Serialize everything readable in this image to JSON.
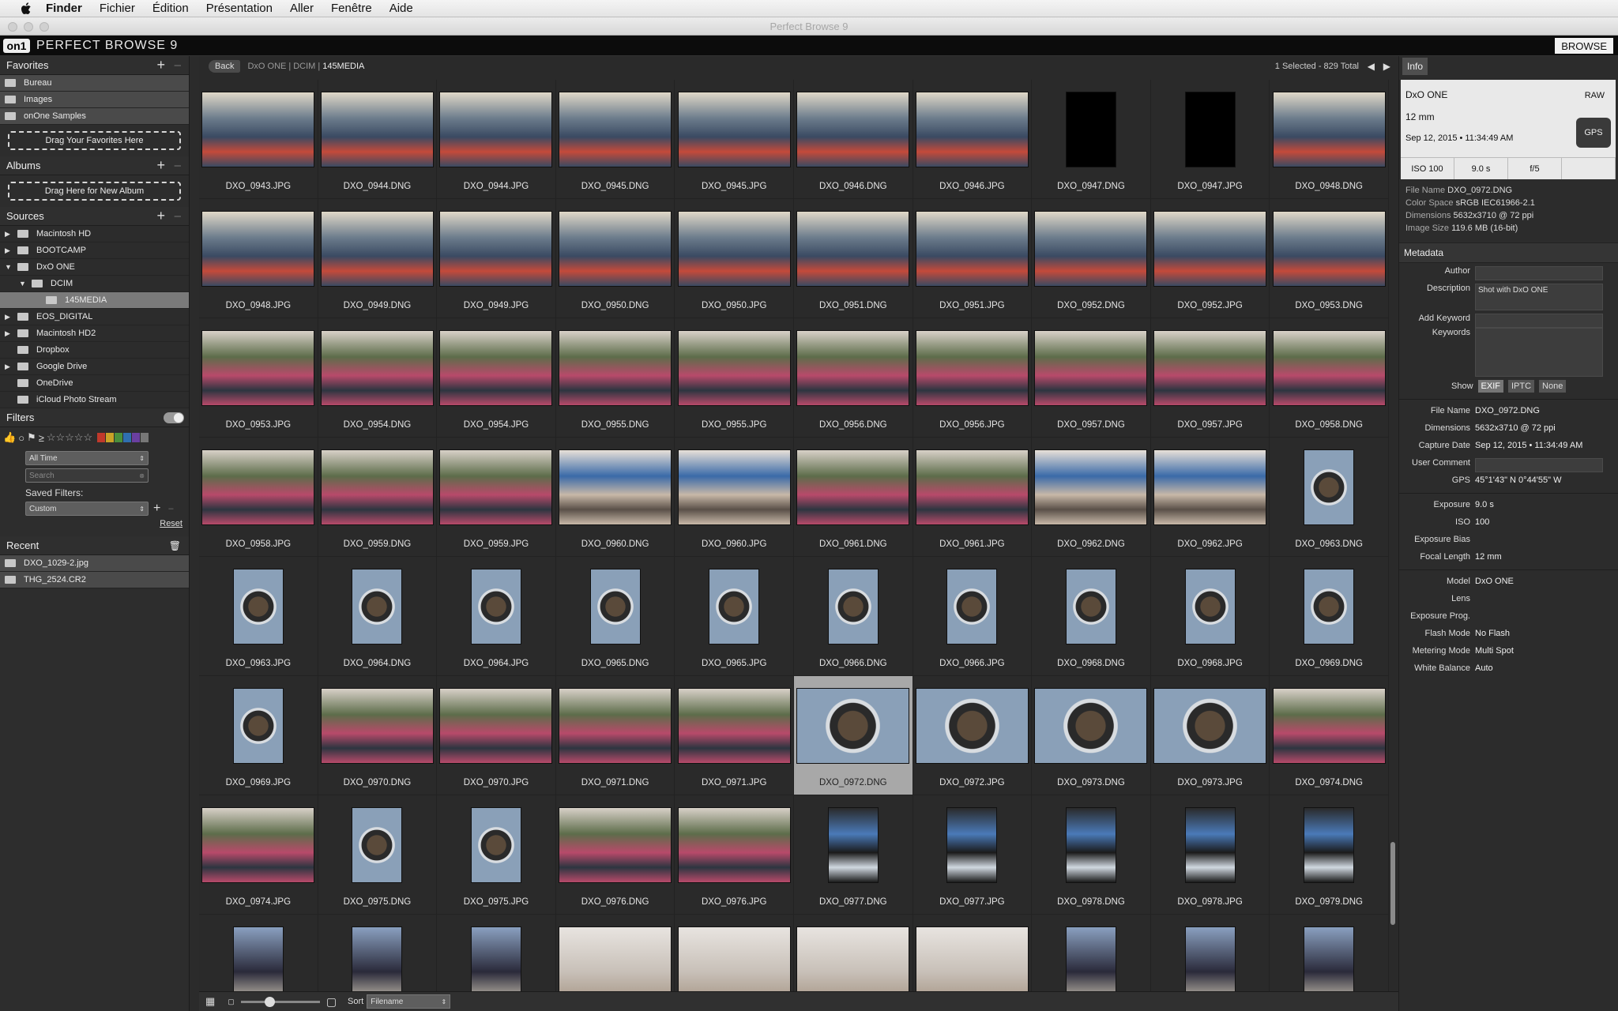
{
  "mac_menu": {
    "items": [
      {
        "label": "Finder",
        "bold": true
      },
      {
        "label": "Fichier"
      },
      {
        "label": "Édition"
      },
      {
        "label": "Présentation"
      },
      {
        "label": "Aller"
      },
      {
        "label": "Fenêtre"
      },
      {
        "label": "Aide"
      }
    ]
  },
  "window": {
    "title": "Perfect Browse 9"
  },
  "appbar": {
    "logo": "on1",
    "name": "PERFECT BROWSE 9",
    "mode_button": "BROWSE"
  },
  "sidebar": {
    "favorites": {
      "title": "Favorites",
      "items": [
        {
          "label": "Bureau"
        },
        {
          "label": "Images"
        },
        {
          "label": "onOne Samples"
        }
      ],
      "dropzone": "Drag Your Favorites Here"
    },
    "albums": {
      "title": "Albums",
      "dropzone": "Drag Here for New Album"
    },
    "sources": {
      "title": "Sources",
      "items": [
        {
          "label": "Macintosh HD",
          "expander": "▶",
          "level": 0
        },
        {
          "label": "BOOTCAMP",
          "expander": "▶",
          "level": 0
        },
        {
          "label": "DxO ONE",
          "expander": "▼",
          "level": 0
        },
        {
          "label": "DCIM",
          "expander": "▼",
          "level": 1
        },
        {
          "label": "145MEDIA",
          "expander": "",
          "level": 2,
          "selected": true
        },
        {
          "label": "EOS_DIGITAL",
          "expander": "▶",
          "level": 0
        },
        {
          "label": "Macintosh HD2",
          "expander": "▶",
          "level": 0
        },
        {
          "label": "Dropbox",
          "expander": "",
          "level": 0
        },
        {
          "label": "Google Drive",
          "expander": "▶",
          "level": 0
        },
        {
          "label": "OneDrive",
          "expander": "",
          "level": 0
        },
        {
          "label": "iCloud Photo Stream",
          "expander": "",
          "level": 0
        }
      ]
    },
    "filters": {
      "title": "Filters",
      "time_select": "All Time",
      "search_placeholder": "Search",
      "saved_filters_label": "Saved Filters:",
      "saved_filter_select": "Custom",
      "reset_label": "Reset",
      "color_labels": [
        "#c0392b",
        "#c9a227",
        "#4a8f3c",
        "#2f6fb0",
        "#6a3fa0",
        "#777777"
      ]
    },
    "recent": {
      "title": "Recent",
      "items": [
        {
          "label": "DXO_1029-2.jpg"
        },
        {
          "label": "THG_2524.CR2"
        }
      ]
    }
  },
  "topbar": {
    "back": "Back",
    "crumbs": [
      "DxO ONE",
      "DCIM",
      "145MEDIA"
    ],
    "count": "1 Selected - 829 Total"
  },
  "grid": {
    "files": [
      "DXO_0943.JPG",
      "DXO_0944.DNG",
      "DXO_0944.JPG",
      "DXO_0945.DNG",
      "DXO_0945.JPG",
      "DXO_0946.DNG",
      "DXO_0946.JPG",
      "DXO_0947.DNG",
      "DXO_0947.JPG",
      "DXO_0948.DNG",
      "DXO_0948.JPG",
      "DXO_0949.DNG",
      "DXO_0949.JPG",
      "DXO_0950.DNG",
      "DXO_0950.JPG",
      "DXO_0951.DNG",
      "DXO_0951.JPG",
      "DXO_0952.DNG",
      "DXO_0952.JPG",
      "DXO_0953.DNG",
      "DXO_0953.JPG",
      "DXO_0954.DNG",
      "DXO_0954.JPG",
      "DXO_0955.DNG",
      "DXO_0955.JPG",
      "DXO_0956.DNG",
      "DXO_0956.JPG",
      "DXO_0957.DNG",
      "DXO_0957.JPG",
      "DXO_0958.DNG",
      "DXO_0958.JPG",
      "DXO_0959.DNG",
      "DXO_0959.JPG",
      "DXO_0960.DNG",
      "DXO_0960.JPG",
      "DXO_0961.DNG",
      "DXO_0961.JPG",
      "DXO_0962.DNG",
      "DXO_0962.JPG",
      "DXO_0963.DNG",
      "DXO_0963.JPG",
      "DXO_0964.DNG",
      "DXO_0964.JPG",
      "DXO_0965.DNG",
      "DXO_0965.JPG",
      "DXO_0966.DNG",
      "DXO_0966.JPG",
      "DXO_0968.DNG",
      "DXO_0968.JPG",
      "DXO_0969.DNG",
      "DXO_0969.JPG",
      "DXO_0970.DNG",
      "DXO_0970.JPG",
      "DXO_0971.DNG",
      "DXO_0971.JPG",
      "DXO_0972.DNG",
      "DXO_0972.JPG",
      "DXO_0973.DNG",
      "DXO_0973.JPG",
      "DXO_0974.DNG",
      "DXO_0974.JPG",
      "DXO_0975.DNG",
      "DXO_0975.JPG",
      "DXO_0976.DNG",
      "DXO_0976.JPG",
      "DXO_0977.DNG",
      "DXO_0977.JPG",
      "DXO_0978.DNG",
      "DXO_0978.JPG",
      "DXO_0979.DNG"
    ],
    "selected": "DXO_0972.DNG"
  },
  "bottombar": {
    "sort_label": "Sort",
    "sort_value": "Filename"
  },
  "info": {
    "tab": "Info",
    "camera": "DxO ONE",
    "format": "RAW",
    "focal": "12 mm",
    "date": "Sep 12, 2015 • 11:34:49 AM",
    "gps_button": "GPS",
    "iso": "ISO 100",
    "shutter": "9.0 s",
    "aperture": "f/5",
    "summary": [
      {
        "k": "File Name",
        "v": "DXO_0972.DNG"
      },
      {
        "k": "Color Space",
        "v": "sRGB IEC61966-2.1"
      },
      {
        "k": "Dimensions",
        "v": "5632x3710 @ 72 ppi"
      },
      {
        "k": "Image Size",
        "v": "119.6 MB (16-bit)"
      }
    ],
    "metadata_title": "Metadata",
    "author_label": "Author",
    "description_label": "Description",
    "description_value": "Shot with DxO ONE",
    "add_keyword_label": "Add Keyword",
    "keywords_label": "Keywords",
    "show_label": "Show",
    "show_options": [
      "EXIF",
      "IPTC",
      "None"
    ],
    "exif1": [
      {
        "k": "File Name",
        "v": "DXO_0972.DNG"
      },
      {
        "k": "Dimensions",
        "v": "5632x3710 @ 72 ppi"
      },
      {
        "k": "Capture Date",
        "v": "Sep 12, 2015 • 11:34:49 AM"
      },
      {
        "k": "User Comment",
        "v": ""
      },
      {
        "k": "GPS",
        "v": "45°1'43\" N 0°44'55\" W"
      }
    ],
    "exif2": [
      {
        "k": "Exposure",
        "v": "9.0 s"
      },
      {
        "k": "ISO",
        "v": "100"
      },
      {
        "k": "Exposure Bias",
        "v": ""
      },
      {
        "k": "Focal Length",
        "v": "12 mm"
      }
    ],
    "exif3": [
      {
        "k": "Model",
        "v": "DxO ONE"
      },
      {
        "k": "Lens",
        "v": ""
      },
      {
        "k": "Exposure Prog.",
        "v": ""
      },
      {
        "k": "Flash Mode",
        "v": "No Flash"
      },
      {
        "k": "Metering Mode",
        "v": "Multi Spot"
      },
      {
        "k": "White Balance",
        "v": "Auto"
      }
    ]
  }
}
